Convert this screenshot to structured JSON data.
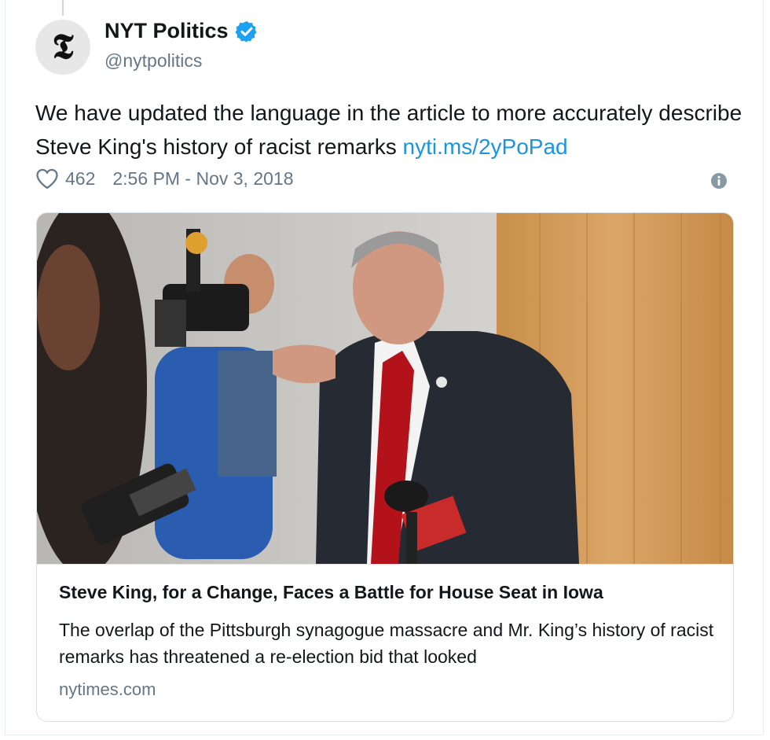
{
  "account": {
    "display_name": "NYT Politics",
    "handle": "@nytpolitics",
    "avatar_glyph": "𝕿",
    "verified": true,
    "verified_color": "#1da1f2"
  },
  "tweet": {
    "text": "We have updated the language in the article to more accurately describe Steve King's history of racist remarks",
    "link": "nyti.ms/2yPoPad",
    "likes": "462",
    "timestamp": "2:56 PM - Nov 3, 2018"
  },
  "card": {
    "title": "Steve King, for a Change, Faces a Battle for House Seat in Iowa",
    "description": "The overlap of the Pittsburgh synagogue massacre and Mr. King’s history of racist remarks has threatened a re-election bid that looked",
    "domain": "nytimes.com",
    "image_subject": "photo of a man in a suit pointing, surrounded by camera crew and microphones"
  },
  "colors": {
    "link": "#1b95e0",
    "secondary_text": "#657786",
    "primary_text": "#14171a"
  }
}
